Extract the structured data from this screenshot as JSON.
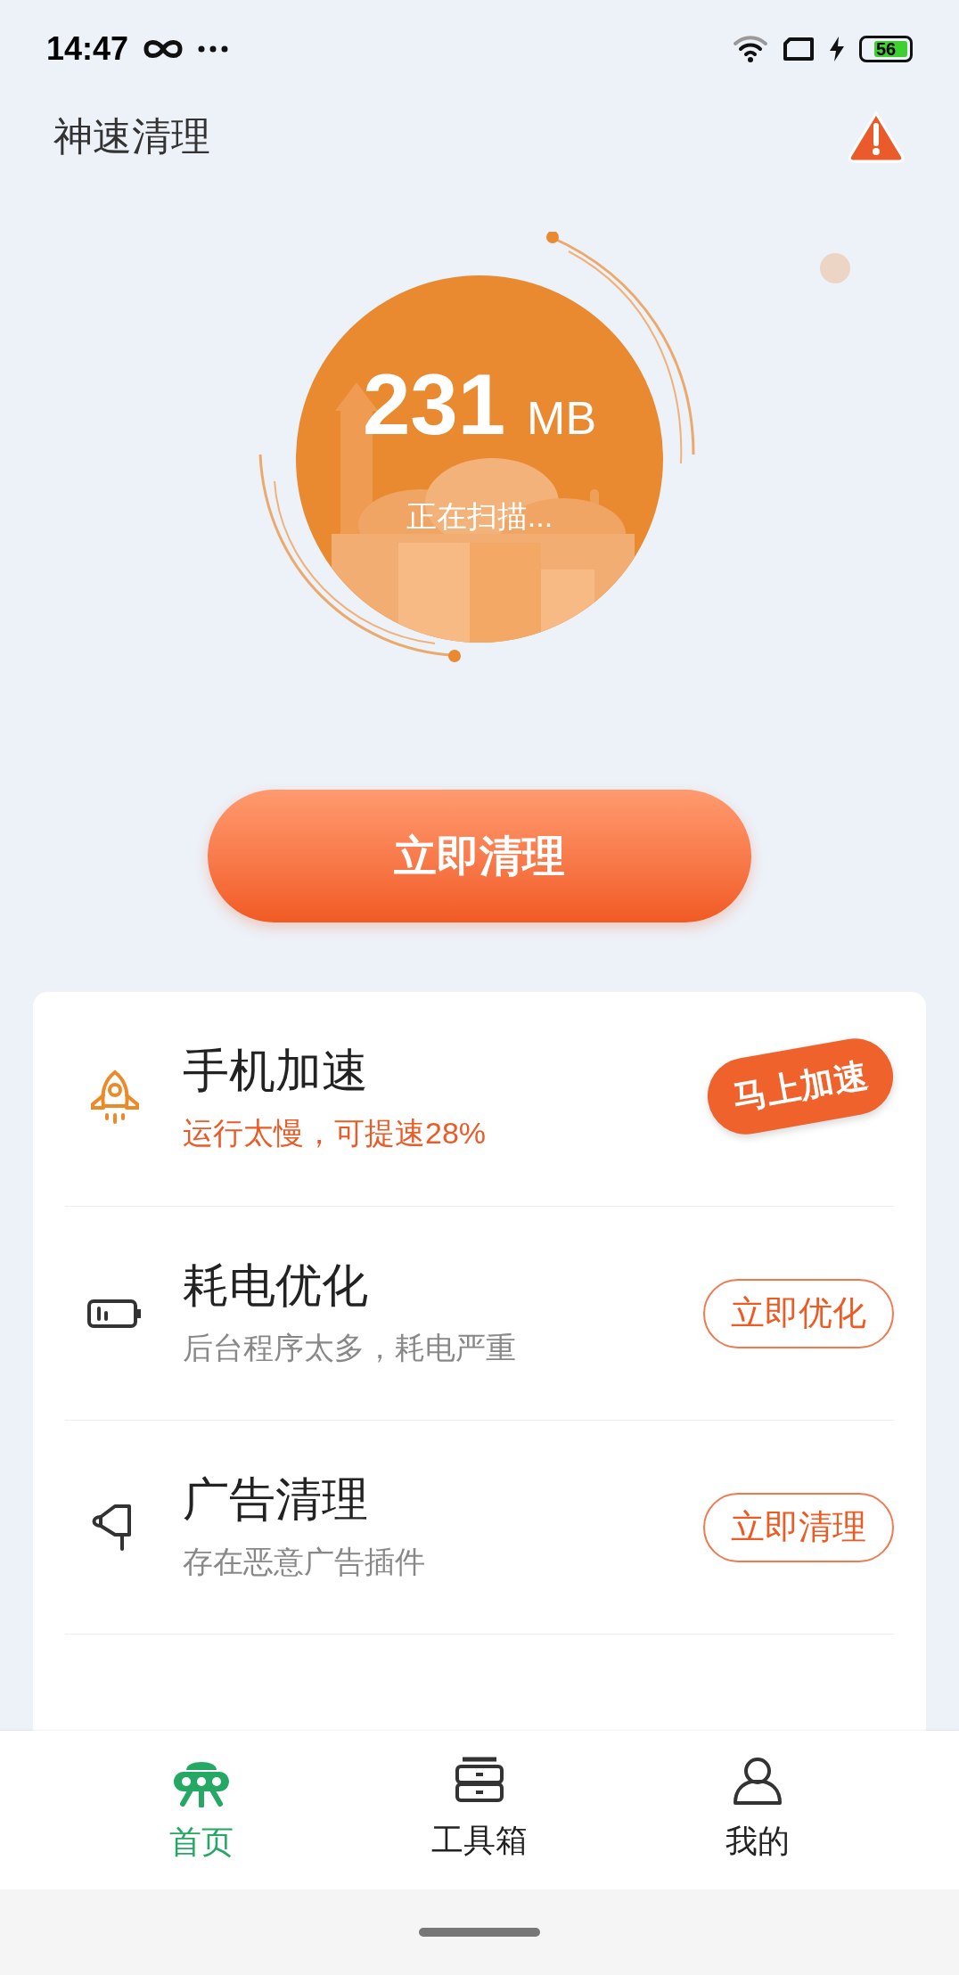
{
  "status_bar": {
    "time": "14:47",
    "battery": "56"
  },
  "header": {
    "title": "神速清理"
  },
  "scan": {
    "amount": "231",
    "unit": "MB",
    "status": "正在扫描..."
  },
  "main_button": "立即清理",
  "items": [
    {
      "title": "手机加速",
      "subtitle": "运行太慢，可提速28%",
      "action": "马上加速",
      "kind": "urgent"
    },
    {
      "title": "耗电优化",
      "subtitle": "后台程序太多，耗电严重",
      "action": "立即优化",
      "kind": "normal"
    },
    {
      "title": "广告清理",
      "subtitle": "存在恶意广告插件",
      "action": "立即清理",
      "kind": "normal"
    }
  ],
  "nav": [
    {
      "label": "首页",
      "selected": true
    },
    {
      "label": "工具箱",
      "selected": false
    },
    {
      "label": "我的",
      "selected": false
    }
  ]
}
